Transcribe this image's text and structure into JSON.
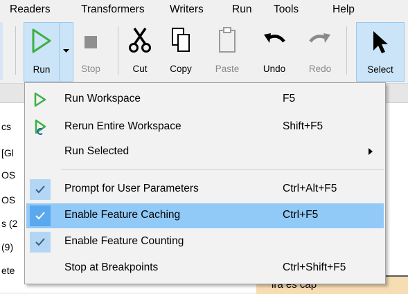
{
  "menubar": {
    "items": [
      "Readers",
      "Transformers",
      "Writers",
      "Run",
      "Tools",
      "Help"
    ]
  },
  "toolbar": {
    "run_label": "Run",
    "stop_label": "Stop",
    "cut_label": "Cut",
    "copy_label": "Copy",
    "paste_label": "Paste",
    "undo_label": "Undo",
    "redo_label": "Redo",
    "select_label": "Select"
  },
  "left_panel": {
    "items": [
      "cs",
      "[Gl",
      "OS",
      "OS",
      "s (2",
      "(9)",
      "ete"
    ]
  },
  "canvas": {
    "text": "ira  es  cap"
  },
  "run_menu": {
    "items": [
      {
        "label": "Run Workspace",
        "shortcut": "F5",
        "icon": "run-icon"
      },
      {
        "label": "Rerun Entire Workspace",
        "shortcut": "Shift+F5",
        "icon": "rerun-icon"
      },
      {
        "label": "Run Selected",
        "shortcut": "",
        "icon": "submenu-arrow-icon"
      },
      {
        "label": "Prompt for User Parameters",
        "shortcut": "Ctrl+Alt+F5",
        "checked": true
      },
      {
        "label": "Enable Feature Caching",
        "shortcut": "Ctrl+F5",
        "checked": true,
        "highlighted": true
      },
      {
        "label": "Enable Feature Counting",
        "shortcut": "",
        "checked": true
      },
      {
        "label": "Stop at Breakpoints",
        "shortcut": "Ctrl+Shift+F5",
        "checked": false
      }
    ]
  },
  "colors": {
    "highlight": "#91c9f7",
    "run_green": "#3cb043",
    "toolbar_active": "#cce4f7"
  }
}
